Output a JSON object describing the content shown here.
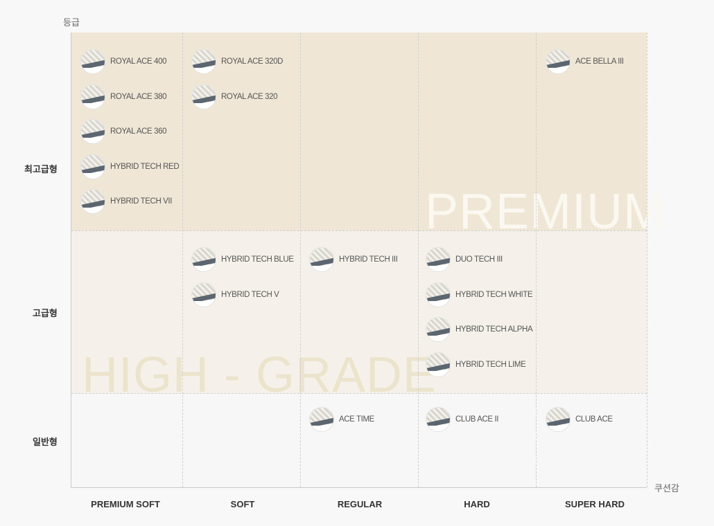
{
  "chart_data": {
    "type": "table",
    "ylabel": "등급",
    "xlabel": "쿠션감",
    "rows": [
      "최고급형",
      "고급형",
      "일반형"
    ],
    "columns": [
      "PREMIUM SOFT",
      "SOFT",
      "REGULAR",
      "HARD",
      "SUPER HARD"
    ],
    "bands": [
      "PREMIUM",
      "HIGH - GRADE"
    ],
    "cells": [
      {
        "row": 0,
        "col": 0,
        "items": [
          "ROYAL ACE 400",
          "ROYAL ACE 380",
          "ROYAL ACE 360",
          "HYBRID TECH RED",
          "HYBRID TECH VII"
        ]
      },
      {
        "row": 0,
        "col": 1,
        "items": [
          "ROYAL ACE 320D",
          "ROYAL ACE 320"
        ]
      },
      {
        "row": 0,
        "col": 4,
        "items": [
          "ACE BELLA III"
        ]
      },
      {
        "row": 1,
        "col": 1,
        "items": [
          "HYBRID TECH BLUE",
          "HYBRID TECH V"
        ]
      },
      {
        "row": 1,
        "col": 2,
        "items": [
          "HYBRID TECH III"
        ]
      },
      {
        "row": 1,
        "col": 3,
        "items": [
          "DUO TECH III",
          "HYBRID TECH WHITE",
          "HYBRID TECH ALPHA",
          "HYBRID TECH LIME"
        ]
      },
      {
        "row": 2,
        "col": 2,
        "items": [
          "ACE TIME"
        ]
      },
      {
        "row": 2,
        "col": 3,
        "items": [
          "CLUB ACE II"
        ]
      },
      {
        "row": 2,
        "col": 4,
        "items": [
          "CLUB ACE"
        ]
      }
    ]
  },
  "icons": {
    "product": "mattress-thumbnail-icon"
  },
  "colors": {
    "premium_band": "#efe6d5",
    "high_band": "#f5f1ea",
    "normal_band": "#f7f7f7"
  }
}
